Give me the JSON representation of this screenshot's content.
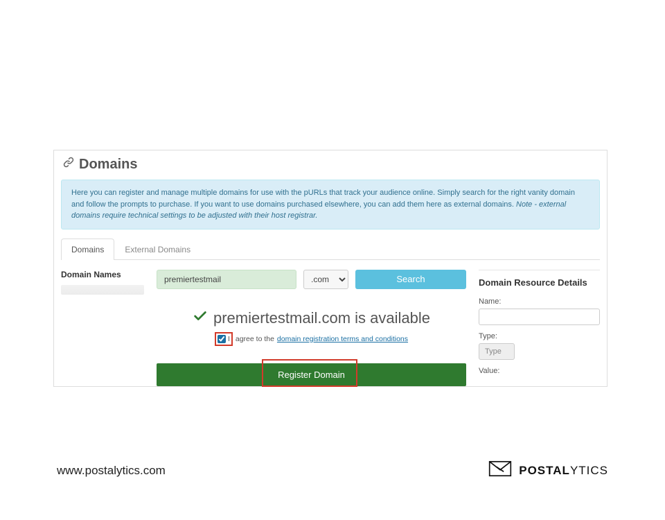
{
  "header": {
    "title": "Domains"
  },
  "info": {
    "text_1": "Here you can register and manage multiple domains for use with the pURLs that track your audience online. Simply search for the right vanity domain and follow the prompts to purchase. If you want to use domains purchased elsewhere, you can add them here as external domains. ",
    "note": "Note - external domains require technical settings to be adjusted with their host registrar."
  },
  "tabs": {
    "domains": "Domains",
    "external": "External Domains"
  },
  "left": {
    "title": "Domain Names"
  },
  "search": {
    "domain_value": "premiertestmail",
    "tld_value": ".com",
    "button": "Search"
  },
  "availability": {
    "text": "premiertestmail.com is available",
    "agree_prefix": "I agree to the ",
    "agree_link": "domain registration terms and conditions"
  },
  "register": {
    "button": "Register Domain"
  },
  "details": {
    "title": "Domain Resource Details",
    "name_label": "Name:",
    "type_label": "Type:",
    "type_value": "Type",
    "value_label": "Value:"
  },
  "footer": {
    "url": "www.postalytics.com",
    "brand_bold": "POSTAL",
    "brand_light": "YTICS"
  }
}
